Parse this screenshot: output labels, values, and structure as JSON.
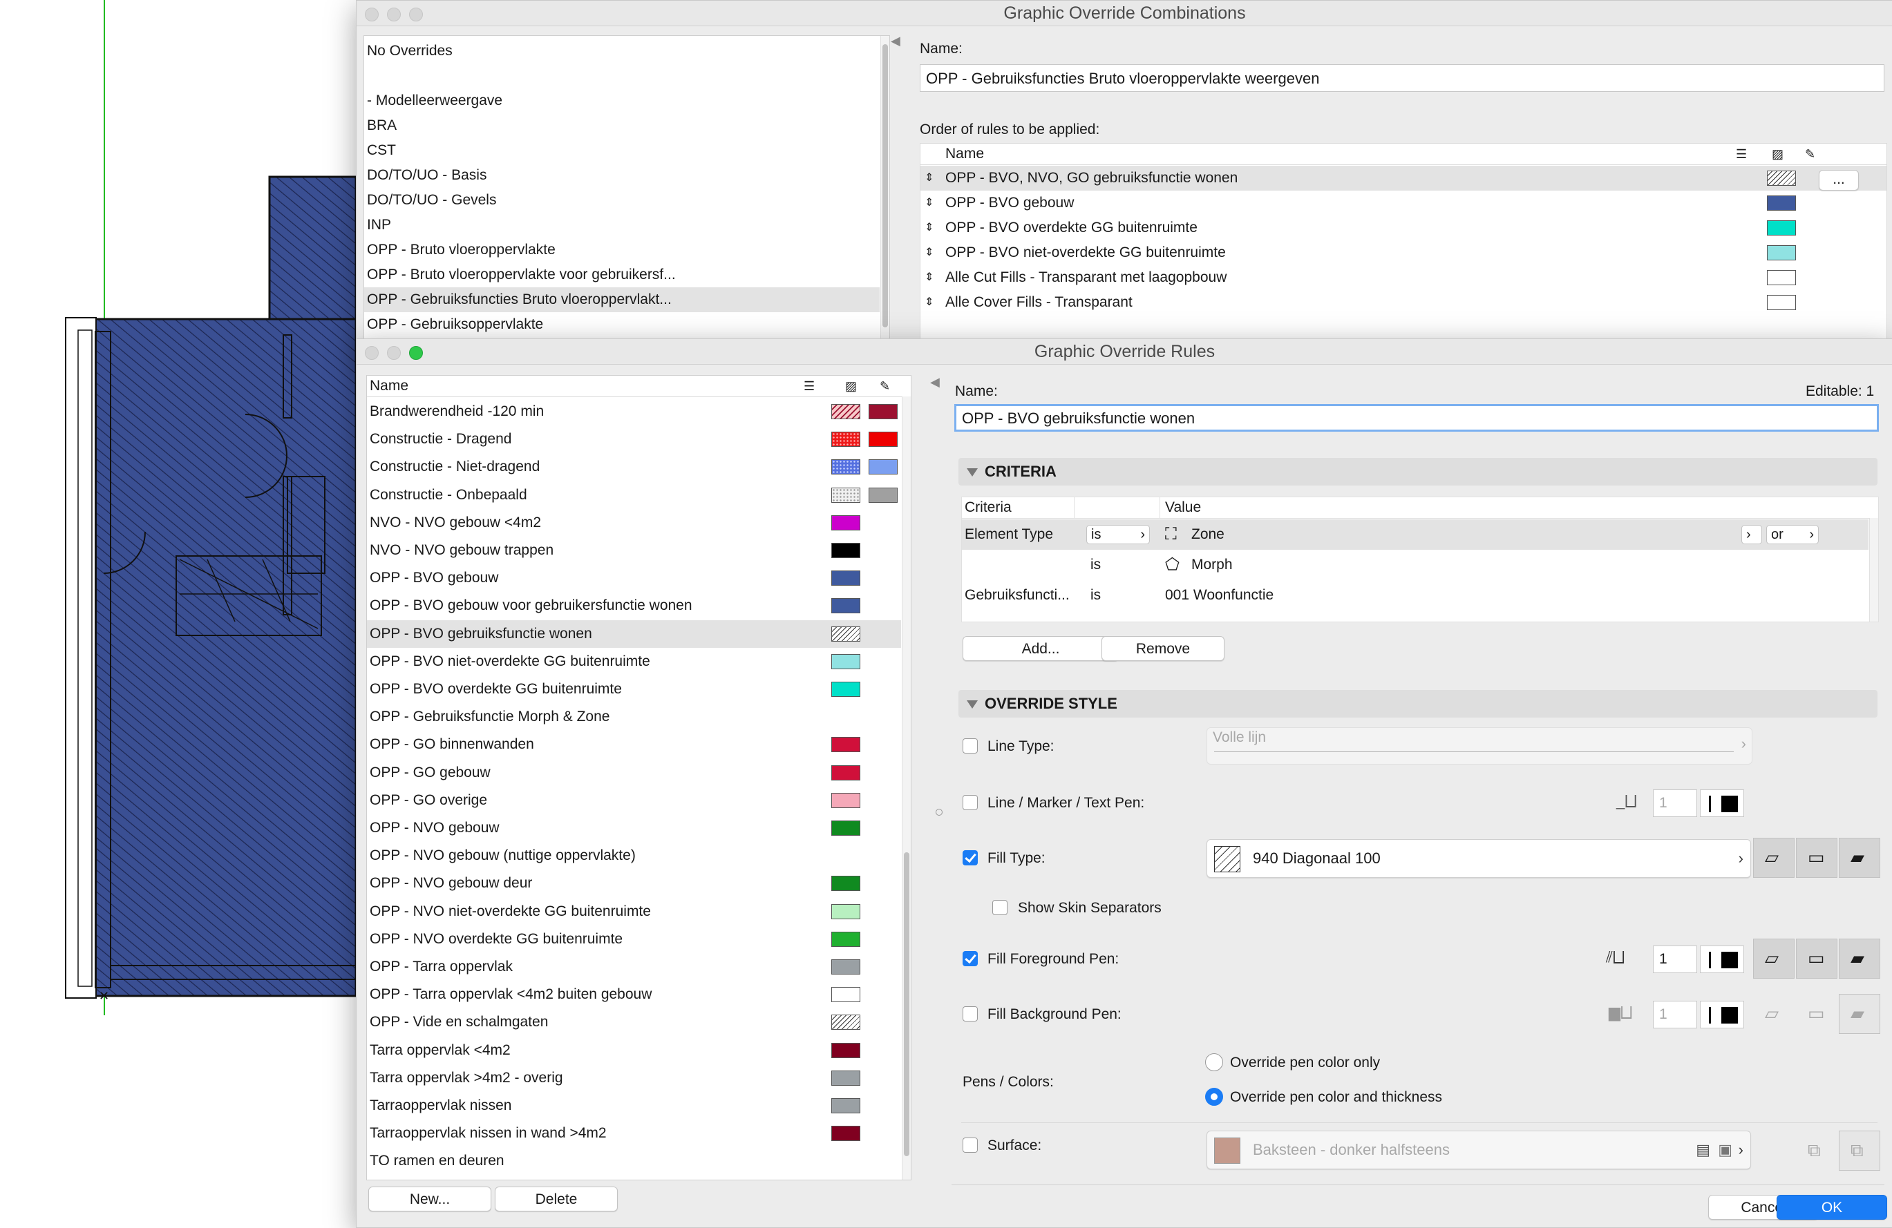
{
  "combos": {
    "title": "Graphic Override Combinations",
    "list": [
      "No Overrides",
      "",
      "- Modelleerweergave",
      "BRA",
      "CST",
      "DO/TO/UO - Basis",
      "DO/TO/UO - Gevels",
      "INP",
      "OPP - Bruto vloeroppervlakte",
      "OPP - Bruto vloeroppervlakte voor gebruikersf...",
      "OPP - Gebruiksfuncties Bruto vloeroppervlakt...",
      "OPP - Gebruiksoppervlakte"
    ],
    "selected_index": 10,
    "name_label": "Name:",
    "name_value": "OPP - Gebruiksfuncties Bruto vloeroppervlakte weergeven",
    "order_label": "Order of rules to be applied:",
    "order_header": "Name",
    "more_button": "...",
    "order_rows": [
      {
        "name": "OPP - BVO, NVO, GO gebruiksfunctie wonen",
        "swatch": "hatch"
      },
      {
        "name": "OPP - BVO gebouw",
        "swatch": "#3f5a9e"
      },
      {
        "name": "OPP - BVO overdekte GG buitenruimte",
        "swatch": "#00e0c8"
      },
      {
        "name": "OPP - BVO niet-overdekte GG buitenruimte",
        "swatch": "#90e2e2"
      },
      {
        "name": "Alle Cut Fills - Transparant met laagopbouw",
        "swatch": "#ffffff"
      },
      {
        "name": "Alle Cover Fills - Transparant",
        "swatch": "#ffffff"
      }
    ]
  },
  "rules": {
    "title": "Graphic Override Rules",
    "list_header": "Name",
    "new_button": "New...",
    "delete_button": "Delete",
    "selected_index": 8,
    "items": [
      {
        "name": "Brandwerendheid -120 min",
        "fill": "hatch-red",
        "pen": "#9b1030"
      },
      {
        "name": "Constructie - Dragend",
        "fill": "dots-red",
        "pen": "#ee0000"
      },
      {
        "name": "Constructie - Niet-dragend",
        "fill": "dots-blue",
        "pen": "#7b9ff0"
      },
      {
        "name": "Constructie - Onbepaald",
        "fill": "dots-grey",
        "pen": "#a0a0a0"
      },
      {
        "name": "NVO - NVO gebouw <4m2",
        "fill": "#cc00cc",
        "pen": ""
      },
      {
        "name": "NVO - NVO gebouw trappen",
        "fill": "#000000",
        "pen": ""
      },
      {
        "name": "OPP - BVO gebouw",
        "fill": "#3f5a9e",
        "pen": ""
      },
      {
        "name": "OPP - BVO gebouw voor gebruikersfunctie wonen",
        "fill": "#3f5a9e",
        "pen": ""
      },
      {
        "name": "OPP - BVO gebruiksfunctie wonen",
        "fill": "hatch",
        "pen": ""
      },
      {
        "name": "OPP - BVO niet-overdekte GG buitenruimte",
        "fill": "#90e2e2",
        "pen": ""
      },
      {
        "name": "OPP - BVO overdekte GG buitenruimte",
        "fill": "#00e0c8",
        "pen": ""
      },
      {
        "name": "OPP - Gebruiksfunctie Morph & Zone",
        "fill": "",
        "pen": ""
      },
      {
        "name": "OPP - GO binnenwanden",
        "fill": "#d0103a",
        "pen": ""
      },
      {
        "name": "OPP - GO gebouw",
        "fill": "#d0103a",
        "pen": ""
      },
      {
        "name": "OPP - GO overige",
        "fill": "#f5a8b8",
        "pen": ""
      },
      {
        "name": "OPP - NVO gebouw",
        "fill": "#108a20",
        "pen": ""
      },
      {
        "name": "OPP - NVO gebouw (nuttige oppervlakte)",
        "fill": "",
        "pen": ""
      },
      {
        "name": "OPP - NVO gebouw deur",
        "fill": "#108a20",
        "pen": ""
      },
      {
        "name": "OPP - NVO niet-overdekte GG buitenruimte",
        "fill": "#b8f0c0",
        "pen": ""
      },
      {
        "name": "OPP - NVO overdekte GG buitenruimte",
        "fill": "#20b030",
        "pen": ""
      },
      {
        "name": "OPP - Tarra oppervlak",
        "fill": "#9aa0a4",
        "pen": ""
      },
      {
        "name": "OPP - Tarra oppervlak <4m2 buiten gebouw",
        "fill": "#ffffff",
        "pen": ""
      },
      {
        "name": "OPP - Vide en schalmgaten",
        "fill": "hatch",
        "pen": ""
      },
      {
        "name": "Tarra oppervlak <4m2",
        "fill": "#800020",
        "pen": ""
      },
      {
        "name": "Tarra oppervlak >4m2 - overig",
        "fill": "#9aa0a4",
        "pen": ""
      },
      {
        "name": "Tarraoppervlak nissen",
        "fill": "#9aa0a4",
        "pen": ""
      },
      {
        "name": "Tarraoppervlak nissen in wand >4m2",
        "fill": "#800020",
        "pen": ""
      },
      {
        "name": "TO ramen en deuren",
        "fill": "",
        "pen": ""
      }
    ],
    "name_label": "Name:",
    "editable": "Editable: 1",
    "name_value": "OPP - BVO gebruiksfunctie wonen",
    "criteria_section": "CRITERIA",
    "criteria_header": [
      "Criteria",
      "Value"
    ],
    "criteria_rows": [
      {
        "criteria": "Element Type",
        "op": "is",
        "value": "Zone",
        "icon": "zone-icon",
        "logic": "or"
      },
      {
        "criteria": "",
        "op": "is",
        "value": "Morph",
        "icon": "morph-icon",
        "logic": ""
      },
      {
        "criteria": "Gebruiksfuncti...",
        "op": "is",
        "value": "001 Woonfunctie",
        "icon": "",
        "logic": ""
      }
    ],
    "add_button": "Add...",
    "remove_button": "Remove",
    "override_section": "OVERRIDE STYLE",
    "line_type": {
      "label": "Line Type:",
      "checked": false,
      "value": "Volle lijn"
    },
    "line_pen": {
      "label": "Line / Marker / Text Pen:",
      "checked": false,
      "value": "1"
    },
    "fill_type": {
      "label": "Fill Type:",
      "checked": true,
      "value": "940 Diagonaal 100"
    },
    "skin_sep": {
      "label": "Show Skin Separators",
      "checked": false
    },
    "fill_fg": {
      "label": "Fill Foreground Pen:",
      "checked": true,
      "value": "1"
    },
    "fill_bg": {
      "label": "Fill Background Pen:",
      "checked": false,
      "value": "1"
    },
    "pens_colors": {
      "label": "Pens / Colors:",
      "opt1": "Override pen color only",
      "opt2": "Override pen color and thickness",
      "selected": 2
    },
    "surface": {
      "label": "Surface:",
      "checked": false,
      "value": "Baksteen - donker halfsteens",
      "swatch": "#c49a8c"
    },
    "cancel_button": "Cancel",
    "ok_button": "OK"
  }
}
